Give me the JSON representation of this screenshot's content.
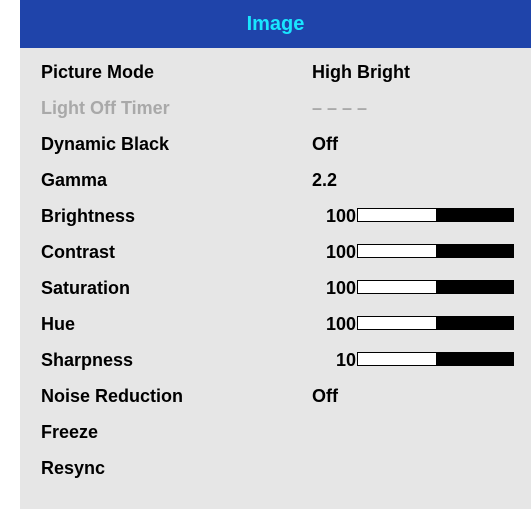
{
  "menu": {
    "title": "Image",
    "rows": [
      {
        "label": "Picture Mode",
        "value": "High Bright"
      },
      {
        "label": "Light Off Timer",
        "value": "– – – –"
      },
      {
        "label": "Dynamic Black",
        "value": "Off"
      },
      {
        "label": "Gamma",
        "value": "2.2"
      },
      {
        "label": "Brightness",
        "value": "100",
        "level": 0.5
      },
      {
        "label": "Contrast",
        "value": "100",
        "level": 0.5
      },
      {
        "label": "Saturation",
        "value": "100",
        "level": 0.5
      },
      {
        "label": "Hue",
        "value": "100",
        "level": 0.5
      },
      {
        "label": "Sharpness",
        "value": "10",
        "level": 0.5
      },
      {
        "label": "Noise Reduction",
        "value": "Off"
      },
      {
        "label": "Freeze"
      },
      {
        "label": "Resync"
      }
    ]
  },
  "colors": {
    "title_bg": "#1f44aa",
    "title_text": "#19e6ff",
    "panel_bg": "#e6e6e6",
    "disabled_text": "#a9a9a9"
  }
}
